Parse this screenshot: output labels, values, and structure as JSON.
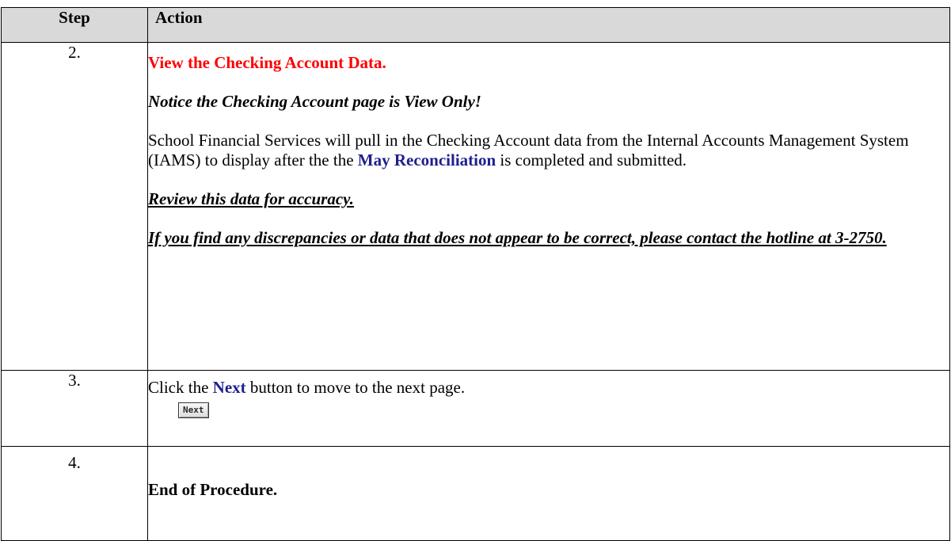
{
  "table": {
    "headers": {
      "step": "Step",
      "action": "Action"
    },
    "rows": [
      {
        "step": "2.",
        "title": "View the Checking Account Data.",
        "notice": "Notice the Checking Account page is View Only!",
        "body_before": "School Financial Services will pull in the Checking Account data from the Internal Accounts Management System (IAMS) to display after the  the ",
        "body_keyword": "May Reconciliation",
        "body_after": " is completed and submitted.",
        "review": "Review this data for accuracy.",
        "contact": "If you find any discrepancies or data that does not appear to be correct, please contact the hotline at 3-2750."
      },
      {
        "step": "3.",
        "text_before": "Click the ",
        "keyword": "Next",
        "text_after": " button to move to the next page.",
        "button_label": "Next"
      },
      {
        "step": "4.",
        "text": "End of Procedure."
      }
    ]
  },
  "colors": {
    "header_bg": "#d9d9d9",
    "title_red": "#ff0000",
    "keyword_blue": "#1f1f8f"
  }
}
